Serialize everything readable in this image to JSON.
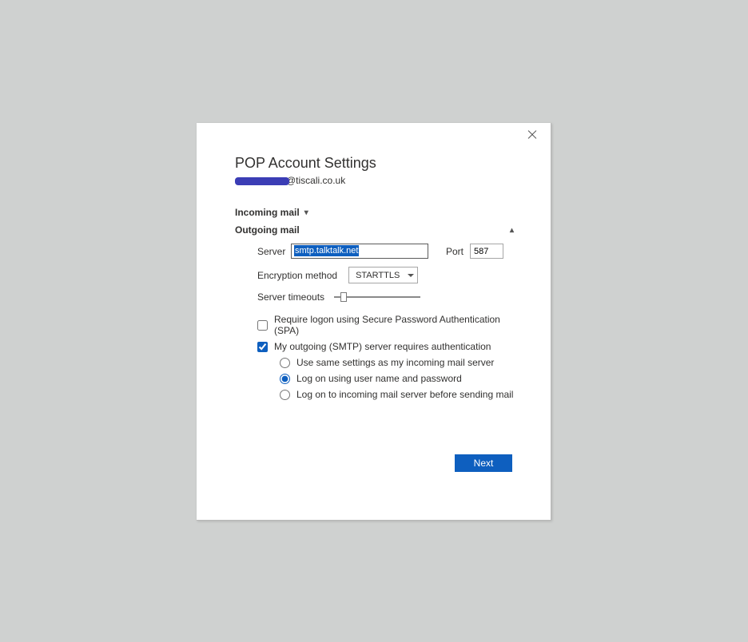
{
  "dialog": {
    "title": "POP Account Settings",
    "email_domain": "@tiscali.co.uk"
  },
  "sections": {
    "incoming_label": "Incoming mail",
    "outgoing_label": "Outgoing mail"
  },
  "outgoing": {
    "server_label": "Server",
    "server_value": "smtp.talktalk.net",
    "port_label": "Port",
    "port_value": "587",
    "encryption_label": "Encryption method",
    "encryption_value": "STARTTLS",
    "timeouts_label": "Server timeouts",
    "spa_label": "Require logon using Secure Password Authentication (SPA)",
    "spa_checked": false,
    "auth_label": "My outgoing (SMTP) server requires authentication",
    "auth_checked": true,
    "radio_same": "Use same settings as my incoming mail server",
    "radio_logon": "Log on using user name and password",
    "radio_before": "Log on to incoming mail server before sending mail",
    "radio_selected": "logon"
  },
  "buttons": {
    "next": "Next"
  }
}
